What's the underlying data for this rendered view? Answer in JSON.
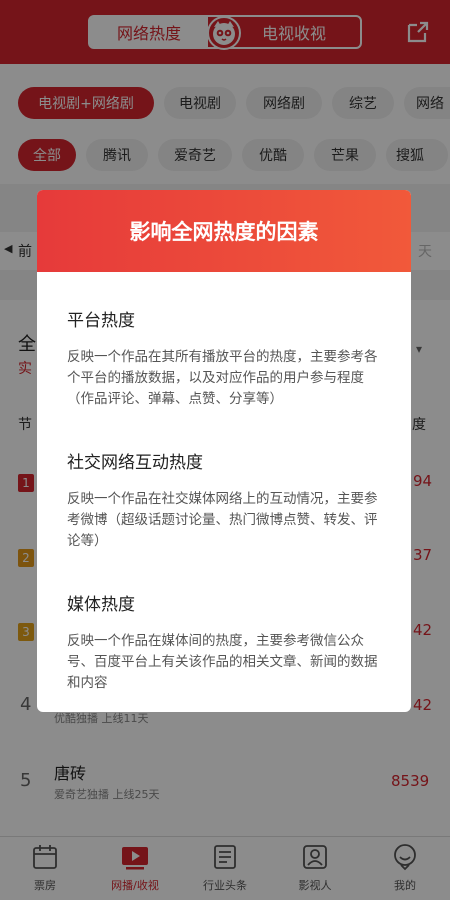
{
  "header": {
    "tab_active": "网络热度",
    "tab_other": "电视收视"
  },
  "filters": {
    "genres": [
      "电视剧+网络剧",
      "电视剧",
      "网络剧",
      "综艺",
      "网络"
    ],
    "platforms": [
      "全部",
      "腾讯",
      "爱奇艺",
      "优酷",
      "芒果",
      "搜狐"
    ]
  },
  "date_bar": {
    "prev": "前",
    "next": "天"
  },
  "list": {
    "section_title_fragment": "全",
    "realtime_fragment": "实",
    "col_left_fragment": "节",
    "col_right_fragment": "度",
    "rows": [
      {
        "rank": "1",
        "score_fragment": "94"
      },
      {
        "rank": "2",
        "score_fragment": "37"
      },
      {
        "rank": "3",
        "score_fragment": "42"
      },
      {
        "rank": "4",
        "sub": "优酷独播  上线11天",
        "score_fragment": "42"
      },
      {
        "rank": "5",
        "title": "唐砖",
        "sub": "爱奇艺独播  上线25天",
        "score": "8539"
      }
    ]
  },
  "modal": {
    "title": "影响全网热度的因素",
    "sections": [
      {
        "title": "平台热度",
        "text": "反映一个作品在其所有播放平台的热度，主要参考各个平台的播放数据，以及对应作品的用户参与程度（作品评论、弹幕、点赞、分享等）"
      },
      {
        "title": "社交网络互动热度",
        "text": "反映一个作品在社交媒体网络上的互动情况，主要参考微博（超级话题讨论量、热门微博点赞、转发、评论等）"
      },
      {
        "title": "媒体热度",
        "text": "反映一个作品在媒体间的热度，主要参考微信公众号、百度平台上有关该作品的相关文章、新闻的数据和内容"
      }
    ]
  },
  "bottom_nav": [
    {
      "label": "票房",
      "icon": "calendar-icon"
    },
    {
      "label": "网播/收视",
      "icon": "play-icon",
      "active": true
    },
    {
      "label": "行业头条",
      "icon": "news-icon"
    },
    {
      "label": "影视人",
      "icon": "person-icon"
    },
    {
      "label": "我的",
      "icon": "profile-icon"
    }
  ],
  "colors": {
    "brand_red": "#d5262f",
    "modal_gradient_start": "#e63a3a",
    "modal_gradient_end": "#f1593a"
  }
}
